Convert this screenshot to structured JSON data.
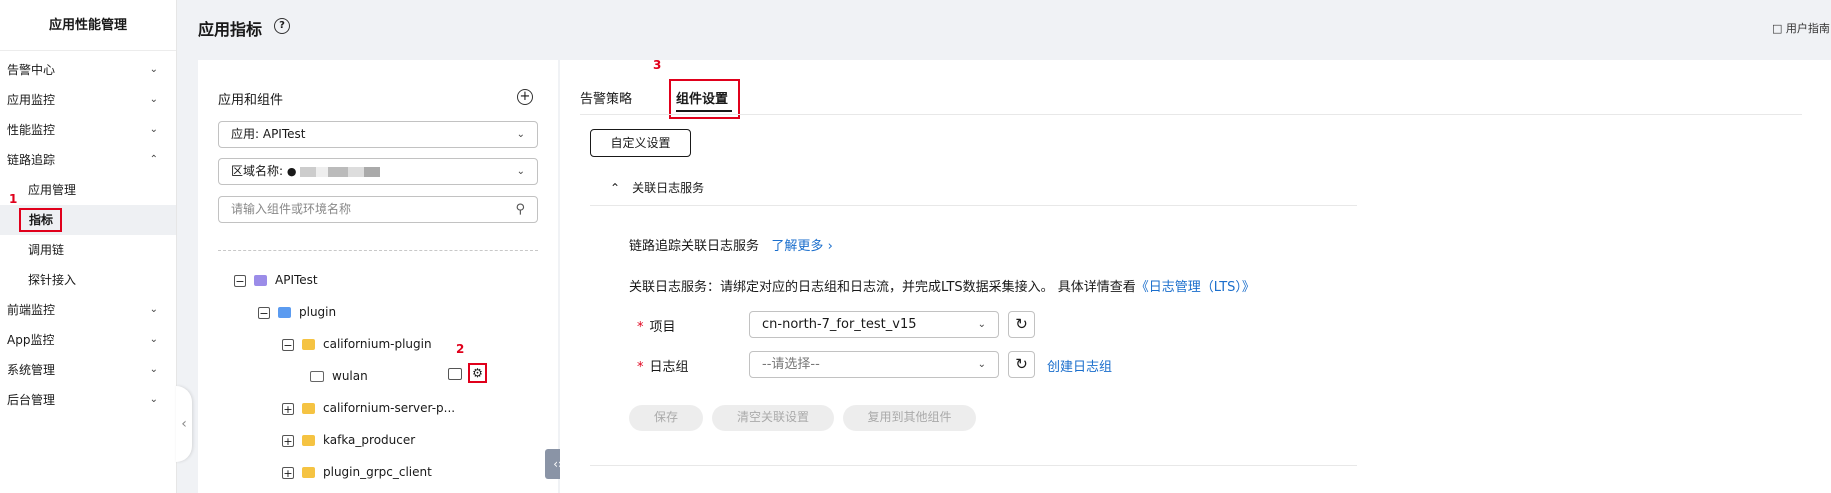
{
  "nav": {
    "title": "应用性能管理",
    "items": [
      {
        "label": "告警中心",
        "chevron": "down"
      },
      {
        "label": "应用监控",
        "chevron": "down"
      },
      {
        "label": "性能监控",
        "chevron": "down"
      },
      {
        "label": "链路追踪",
        "chevron": "up"
      },
      {
        "label": "前端监控",
        "chevron": "down"
      },
      {
        "label": "App监控",
        "chevron": "down"
      },
      {
        "label": "系统管理",
        "chevron": "down"
      },
      {
        "label": "后台管理",
        "chevron": "down"
      }
    ],
    "sub_items": [
      {
        "label": "应用管理"
      },
      {
        "label": "指标",
        "active": true
      },
      {
        "label": "调用链"
      },
      {
        "label": "探针接入"
      }
    ]
  },
  "annotations": {
    "n1": "1",
    "n2": "2",
    "n3": "3"
  },
  "header": {
    "title": "应用指标",
    "help": "?",
    "user_guide": "用户指南"
  },
  "tree_panel": {
    "title": "应用和组件",
    "app_select": "应用:  APITest",
    "region_label": "区域名称:",
    "search_placeholder": "请输入组件或环境名称",
    "nodes": [
      {
        "label": "APITest",
        "toggle": "−"
      },
      {
        "label": "plugin",
        "toggle": "−"
      },
      {
        "label": "californium-plugin",
        "toggle": "−"
      },
      {
        "label": "wulan",
        "toggle": ""
      },
      {
        "label": "californium-server-p...",
        "toggle": "+"
      },
      {
        "label": "kafka_producer",
        "toggle": "+"
      },
      {
        "label": "plugin_grpc_client",
        "toggle": "+"
      }
    ]
  },
  "main": {
    "tabs": [
      {
        "label": "告警策略"
      },
      {
        "label": "组件设置",
        "active": true
      }
    ],
    "custom_button": "自定义设置",
    "section_title": "关联日志服务",
    "desc1": "链路追踪关联日志服务",
    "learn_more": "了解更多",
    "desc2": "关联日志服务：请绑定对应的日志组和日志流，并完成LTS数据采集接入。 具体详情查看",
    "lts_link": "《日志管理（LTS）》",
    "project_label": "项目",
    "project_value": "cn-north-7_for_test_v15",
    "log_group_label": "日志组",
    "log_group_placeholder": "--请选择--",
    "create_log_group": "创建日志组",
    "buttons": {
      "save": "保存",
      "clear": "清空关联设置",
      "copy": "复用到其他组件"
    }
  },
  "colors": {
    "accent": "#1a6ecc",
    "annotation_red": "#e0001b",
    "component_yellow": "#f5c342",
    "folder_blue": "#5b9bf0",
    "app_purple": "#9b8ce8"
  }
}
